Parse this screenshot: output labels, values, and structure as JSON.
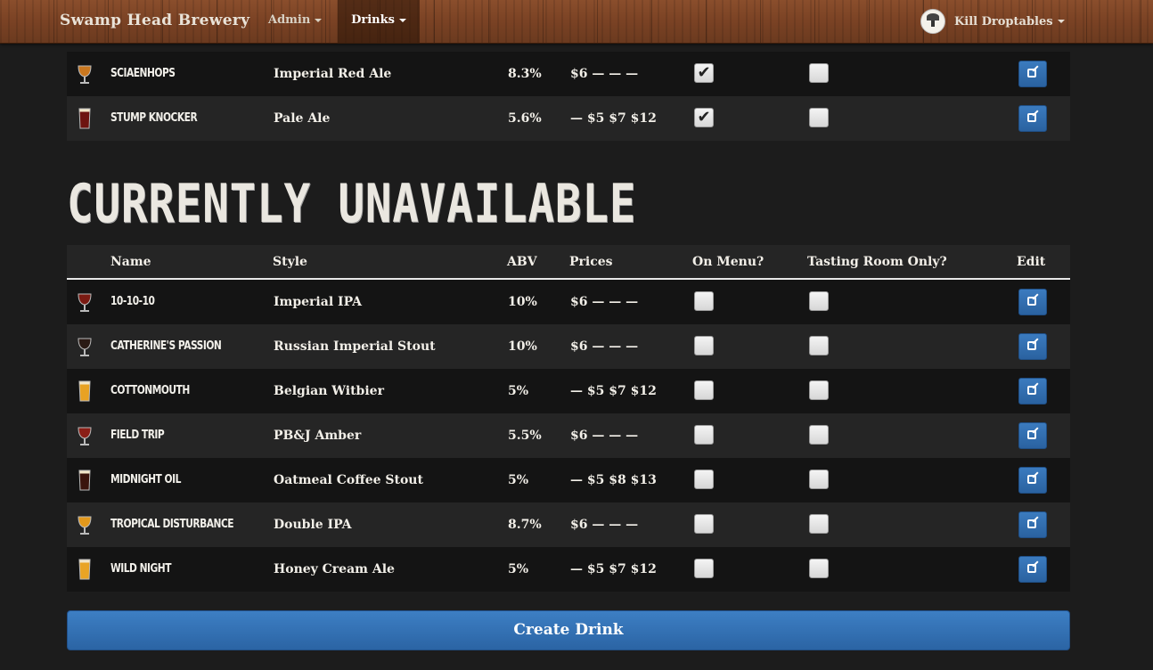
{
  "navbar": {
    "brand": "Swamp Head Brewery",
    "menus": [
      {
        "label": "Admin"
      },
      {
        "label": "Drinks"
      }
    ],
    "user": {
      "name": "Kill Droptables"
    }
  },
  "available_rows": [
    {
      "name": "Sciaenhops",
      "style": "Imperial Red Ale",
      "abv": "8.3%",
      "prices": "$6 — — —",
      "on_menu": true,
      "tasting_room_only": false,
      "glass": "snifter",
      "glass_color": "#c9771f"
    },
    {
      "name": "Stump Knocker",
      "style": "Pale Ale",
      "abv": "5.6%",
      "prices": "— $5 $7 $12",
      "on_menu": true,
      "tasting_room_only": false,
      "glass": "pint",
      "glass_color": "#6e1410"
    }
  ],
  "unavailable": {
    "heading": "CURRENTLY UNAVAILABLE",
    "columns": [
      "Name",
      "Style",
      "ABV",
      "Prices",
      "On Menu?",
      "Tasting Room Only?",
      "Edit"
    ],
    "rows": [
      {
        "name": "10-10-10",
        "style": "Imperial IPA",
        "abv": "10%",
        "prices": "$6 — — —",
        "on_menu": false,
        "tasting_room_only": false,
        "glass": "snifter",
        "glass_color": "#7a1a12"
      },
      {
        "name": "Catherine's Passion",
        "style": "Russian Imperial Stout",
        "abv": "10%",
        "prices": "$6 — — —",
        "on_menu": false,
        "tasting_room_only": false,
        "glass": "snifter",
        "glass_color": "#2a1a14"
      },
      {
        "name": "Cottonmouth",
        "style": "Belgian Witbier",
        "abv": "5%",
        "prices": "— $5 $7 $12",
        "on_menu": false,
        "tasting_room_only": false,
        "glass": "pint",
        "glass_color": "#e8a223"
      },
      {
        "name": "Field Trip",
        "style": "PB&J Amber",
        "abv": "5.5%",
        "prices": "$6 — — —",
        "on_menu": false,
        "tasting_room_only": false,
        "glass": "snifter",
        "glass_color": "#8a1e16"
      },
      {
        "name": "Midnight Oil",
        "style": "Oatmeal Coffee Stout",
        "abv": "5%",
        "prices": "— $5 $8 $13",
        "on_menu": false,
        "tasting_room_only": false,
        "glass": "pint",
        "glass_color": "#3a130c"
      },
      {
        "name": "Tropical Disturbance",
        "style": "Double IPA",
        "abv": "8.7%",
        "prices": "$6 — — —",
        "on_menu": false,
        "tasting_room_only": false,
        "glass": "snifter",
        "glass_color": "#e2981c"
      },
      {
        "name": "Wild Night",
        "style": "Honey Cream Ale",
        "abv": "5%",
        "prices": "— $5 $7 $12",
        "on_menu": false,
        "tasting_room_only": false,
        "glass": "pint",
        "glass_color": "#e9a425"
      }
    ]
  },
  "create_button": "Create Drink",
  "colors": {
    "background": "#1c1c1c",
    "row_dark": "#141414",
    "row_light": "#252525",
    "button_blue": "#2f6cb0"
  },
  "icons": {
    "edit": "edit-icon",
    "checkbox_checked": "check-icon",
    "caret": "caret-down-icon"
  }
}
